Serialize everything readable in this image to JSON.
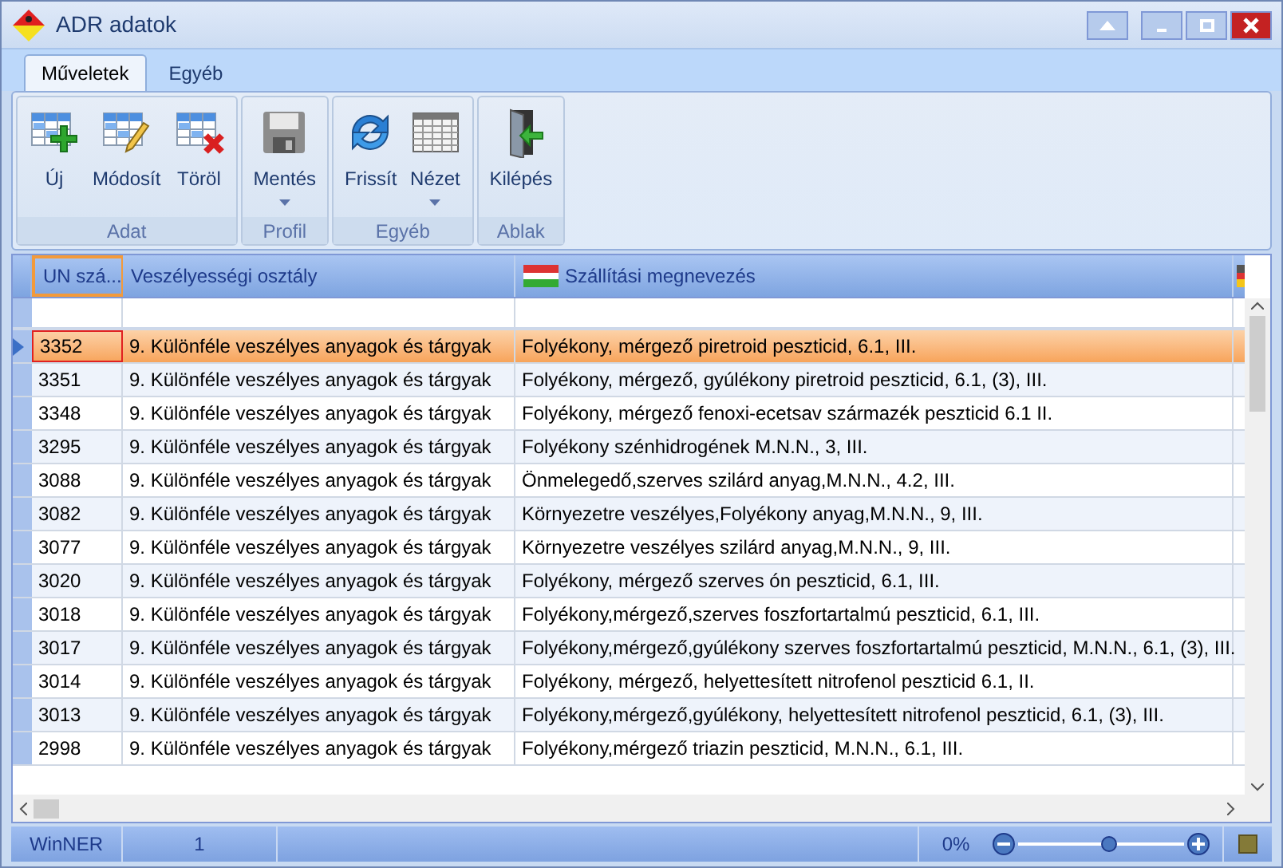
{
  "window": {
    "title": "ADR adatok"
  },
  "tabs": [
    {
      "label": "Műveletek",
      "selected": true
    },
    {
      "label": "Egyéb",
      "selected": false
    }
  ],
  "ribbon_groups": [
    {
      "label": "Adat",
      "buttons": [
        {
          "label": "Új",
          "kind": "new",
          "dropdown": false
        },
        {
          "label": "Módosít",
          "kind": "edit",
          "dropdown": false
        },
        {
          "label": "Töröl",
          "kind": "delete",
          "dropdown": false
        }
      ]
    },
    {
      "label": "Profil",
      "buttons": [
        {
          "label": "Mentés",
          "kind": "save",
          "dropdown": true
        }
      ]
    },
    {
      "label": "Egyéb",
      "buttons": [
        {
          "label": "Frissít",
          "kind": "refresh",
          "dropdown": false
        },
        {
          "label": "Nézet",
          "kind": "grid",
          "dropdown": true
        }
      ]
    },
    {
      "label": "Ablak",
      "buttons": [
        {
          "label": "Kilépés",
          "kind": "exit",
          "dropdown": false
        }
      ]
    }
  ],
  "table": {
    "columns": [
      "UN szá...",
      "Veszélyességi osztály",
      "Szállítási megnevezés"
    ],
    "rows": [
      {
        "cells": [
          "3352",
          "9. Különféle veszélyes anyagok és tárgyak",
          "Folyékony, mérgező piretroid peszticid, 6.1, III."
        ],
        "selected": true
      },
      {
        "cells": [
          "3351",
          "9. Különféle veszélyes anyagok és tárgyak",
          "Folyékony, mérgező, gyúlékony piretroid peszticid, 6.1, (3), III."
        ],
        "selected": false
      },
      {
        "cells": [
          "3348",
          "9. Különféle veszélyes anyagok és tárgyak",
          "Folyékony, mérgező fenoxi-ecetsav származék peszticid 6.1 II."
        ],
        "selected": false
      },
      {
        "cells": [
          "3295",
          "9. Különféle veszélyes anyagok és tárgyak",
          "Folyékony szénhidrogének M.N.N., 3, III."
        ],
        "selected": false
      },
      {
        "cells": [
          "3088",
          "9. Különféle veszélyes anyagok és tárgyak",
          "Önmelegedő,szerves szilárd anyag,M.N.N., 4.2, III."
        ],
        "selected": false
      },
      {
        "cells": [
          "3082",
          "9. Különféle veszélyes anyagok és tárgyak",
          "Környezetre veszélyes,Folyékony anyag,M.N.N., 9, III."
        ],
        "selected": false
      },
      {
        "cells": [
          "3077",
          "9. Különféle veszélyes anyagok és tárgyak",
          "Környezetre veszélyes szilárd anyag,M.N.N., 9, III."
        ],
        "selected": false
      },
      {
        "cells": [
          "3020",
          "9. Különféle veszélyes anyagok és tárgyak",
          "Folyékony, mérgező szerves ón peszticid, 6.1, III."
        ],
        "selected": false
      },
      {
        "cells": [
          "3018",
          "9. Különféle veszélyes anyagok és tárgyak",
          "Folyékony,mérgező,szerves foszfortartalmú peszticid, 6.1, III."
        ],
        "selected": false
      },
      {
        "cells": [
          "3017",
          "9. Különféle veszélyes anyagok és tárgyak",
          "Folyékony,mérgező,gyúlékony szerves foszfortartalmú peszticid, M.N.N., 6.1, (3), III."
        ],
        "selected": false
      },
      {
        "cells": [
          "3014",
          "9. Különféle veszélyes anyagok és tárgyak",
          "Folyékony, mérgező, helyettesített nitrofenol peszticid 6.1, II."
        ],
        "selected": false
      },
      {
        "cells": [
          "3013",
          "9. Különféle veszélyes anyagok és tárgyak",
          "Folyékony,mérgező,gyúlékony, helyettesített nitrofenol peszticid, 6.1, (3), III."
        ],
        "selected": false
      },
      {
        "cells": [
          "2998",
          "9. Különféle veszélyes anyagok és tárgyak",
          "Folyékony,mérgező triazin peszticid, M.N.N., 6.1, III."
        ],
        "selected": false
      }
    ]
  },
  "status_bar": {
    "app": "WinNER",
    "count": "1",
    "zoom_text": "0%",
    "zoom": {
      "level": 0.55
    }
  }
}
